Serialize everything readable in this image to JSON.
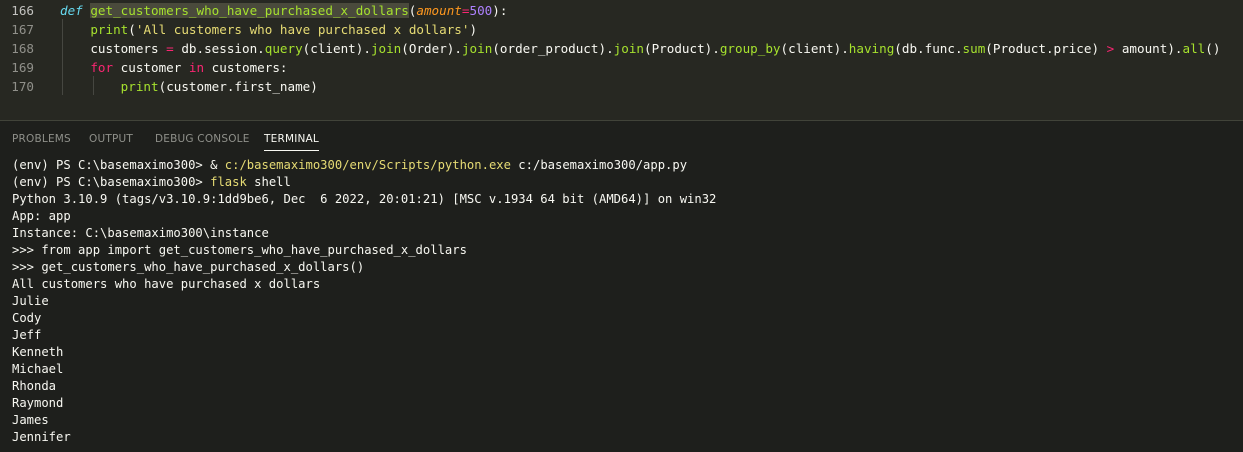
{
  "editor": {
    "lines": [
      {
        "number": "166",
        "tokens": [
          {
            "t": "def",
            "c": "t-def"
          },
          {
            "t": " ",
            "c": "t-id"
          },
          {
            "t": "get_customers_who_have_purchased_x_dollars",
            "c": "t-fn-hl"
          },
          {
            "t": "(",
            "c": "t-paren"
          },
          {
            "t": "amount",
            "c": "t-param"
          },
          {
            "t": "=",
            "c": "t-op"
          },
          {
            "t": "500",
            "c": "t-num"
          },
          {
            "t": "):",
            "c": "t-paren"
          }
        ]
      },
      {
        "number": "167",
        "tokens": [
          {
            "t": "    ",
            "c": "t-id"
          },
          {
            "t": "print",
            "c": "t-fn"
          },
          {
            "t": "(",
            "c": "t-paren"
          },
          {
            "t": "'All customers who have purchased x dollars'",
            "c": "t-str"
          },
          {
            "t": ")",
            "c": "t-paren"
          }
        ]
      },
      {
        "number": "168",
        "tokens": [
          {
            "t": "    customers ",
            "c": "t-id"
          },
          {
            "t": "=",
            "c": "t-op"
          },
          {
            "t": " db.session.",
            "c": "t-id"
          },
          {
            "t": "query",
            "c": "t-fn"
          },
          {
            "t": "(",
            "c": "t-paren"
          },
          {
            "t": "client",
            "c": "t-id"
          },
          {
            "t": ").",
            "c": "t-paren"
          },
          {
            "t": "join",
            "c": "t-fn"
          },
          {
            "t": "(",
            "c": "t-paren"
          },
          {
            "t": "Order",
            "c": "t-id"
          },
          {
            "t": ").",
            "c": "t-paren"
          },
          {
            "t": "join",
            "c": "t-fn"
          },
          {
            "t": "(",
            "c": "t-paren"
          },
          {
            "t": "order_product",
            "c": "t-id"
          },
          {
            "t": ").",
            "c": "t-paren"
          },
          {
            "t": "join",
            "c": "t-fn"
          },
          {
            "t": "(",
            "c": "t-paren"
          },
          {
            "t": "Product",
            "c": "t-id"
          },
          {
            "t": ").",
            "c": "t-paren"
          },
          {
            "t": "group_by",
            "c": "t-fn"
          },
          {
            "t": "(",
            "c": "t-paren"
          },
          {
            "t": "client",
            "c": "t-id"
          },
          {
            "t": ").",
            "c": "t-paren"
          },
          {
            "t": "having",
            "c": "t-fn"
          },
          {
            "t": "(",
            "c": "t-paren"
          },
          {
            "t": "db.func.",
            "c": "t-id"
          },
          {
            "t": "sum",
            "c": "t-fn"
          },
          {
            "t": "(",
            "c": "t-paren"
          },
          {
            "t": "Product.price",
            "c": "t-id"
          },
          {
            "t": ") ",
            "c": "t-paren"
          },
          {
            "t": ">",
            "c": "t-op"
          },
          {
            "t": " amount",
            "c": "t-id"
          },
          {
            "t": ").",
            "c": "t-paren"
          },
          {
            "t": "all",
            "c": "t-fn"
          },
          {
            "t": "()",
            "c": "t-paren"
          }
        ]
      },
      {
        "number": "169",
        "tokens": [
          {
            "t": "    ",
            "c": "t-id"
          },
          {
            "t": "for",
            "c": "t-kw"
          },
          {
            "t": " customer ",
            "c": "t-id"
          },
          {
            "t": "in",
            "c": "t-kw"
          },
          {
            "t": " customers",
            "c": "t-id"
          },
          {
            "t": ":",
            "c": "t-paren"
          }
        ]
      },
      {
        "number": "170",
        "tokens": [
          {
            "t": "        ",
            "c": "t-id"
          },
          {
            "t": "print",
            "c": "t-fn"
          },
          {
            "t": "(",
            "c": "t-paren"
          },
          {
            "t": "customer.first_name",
            "c": "t-id"
          },
          {
            "t": ")",
            "c": "t-paren"
          }
        ]
      }
    ]
  },
  "panel": {
    "tabs": [
      {
        "label": "PROBLEMS",
        "active": false,
        "name": "tab-problems"
      },
      {
        "label": "OUTPUT",
        "active": false,
        "name": "tab-output"
      },
      {
        "label": "DEBUG CONSOLE",
        "active": false,
        "name": "tab-debug-console"
      },
      {
        "label": "TERMINAL",
        "active": true,
        "name": "tab-terminal"
      }
    ]
  },
  "terminal": {
    "lines": [
      [
        {
          "t": "(env) PS C:\\basemaximo300> & ",
          "c": "white"
        },
        {
          "t": "c:/basemaximo300/env/Scripts/python.exe",
          "c": "yellow"
        },
        {
          "t": " c:/basemaximo300/app.py",
          "c": "white"
        }
      ],
      [
        {
          "t": "(env) PS C:\\basemaximo300> ",
          "c": "white"
        },
        {
          "t": "flask",
          "c": "yellow"
        },
        {
          "t": " shell",
          "c": "white"
        }
      ],
      [
        {
          "t": "Python 3.10.9 (tags/v3.10.9:1dd9be6, Dec  6 2022, 20:01:21) [MSC v.1934 64 bit (AMD64)] on win32",
          "c": "white"
        }
      ],
      [
        {
          "t": "App: app",
          "c": "white"
        }
      ],
      [
        {
          "t": "Instance: C:\\basemaximo300\\instance",
          "c": "white"
        }
      ],
      [
        {
          "t": ">>> from app import get_customers_who_have_purchased_x_dollars",
          "c": "white"
        }
      ],
      [
        {
          "t": ">>> get_customers_who_have_purchased_x_dollars()",
          "c": "white"
        }
      ],
      [
        {
          "t": "All customers who have purchased x dollars",
          "c": "white"
        }
      ],
      [
        {
          "t": "Julie",
          "c": "white"
        }
      ],
      [
        {
          "t": "Cody",
          "c": "white"
        }
      ],
      [
        {
          "t": "Jeff",
          "c": "white"
        }
      ],
      [
        {
          "t": "Kenneth",
          "c": "white"
        }
      ],
      [
        {
          "t": "Michael",
          "c": "white"
        }
      ],
      [
        {
          "t": "Rhonda",
          "c": "white"
        }
      ],
      [
        {
          "t": "Raymond",
          "c": "white"
        }
      ],
      [
        {
          "t": "James",
          "c": "white"
        }
      ],
      [
        {
          "t": "Jennifer",
          "c": "white"
        }
      ]
    ]
  }
}
